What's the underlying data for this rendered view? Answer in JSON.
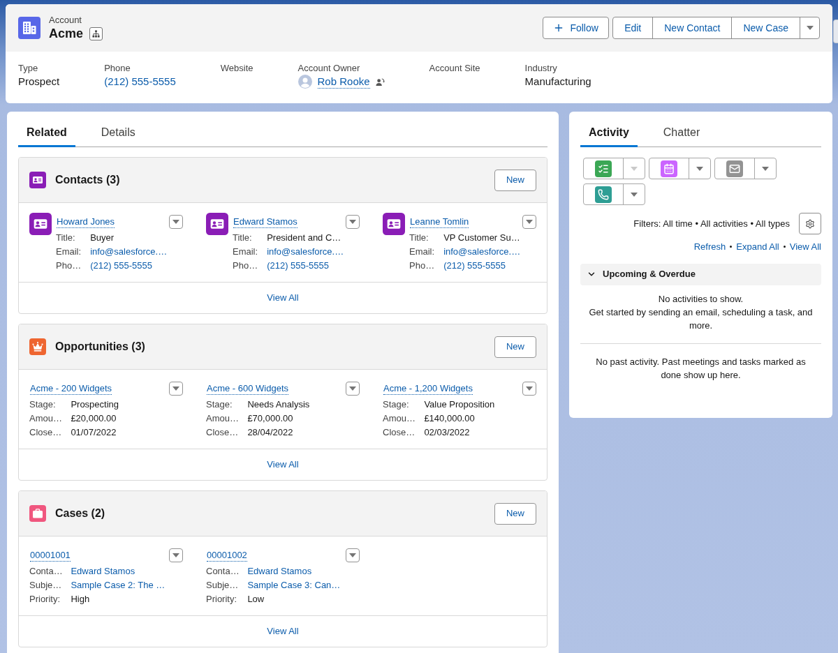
{
  "record_header": {
    "object_label": "Account",
    "title": "Acme",
    "follow_button": "Follow",
    "actions": [
      "Edit",
      "New Contact",
      "New Case"
    ]
  },
  "highlights": [
    {
      "label": "Type",
      "kind": "text",
      "value": "Prospect"
    },
    {
      "label": "Phone",
      "kind": "link",
      "value": "(212) 555-5555"
    },
    {
      "label": "Website"
    },
    {
      "label": "Account Owner",
      "kind": "owner",
      "value": "Rob Rooke"
    },
    {
      "label": "Account Site"
    },
    {
      "label": "Industry",
      "kind": "text",
      "value": "Manufacturing"
    }
  ],
  "main_tabs": [
    {
      "label": "Related",
      "selected": true
    },
    {
      "label": "Details",
      "selected": false
    }
  ],
  "related_lists": [
    {
      "kind": "contacts",
      "title": "Contacts (3)",
      "new_button": "New",
      "footer_link": "View All",
      "tiles": [
        {
          "name": "Howard Jones",
          "fields": [
            {
              "label": "Title:",
              "kind": "text",
              "value": "Buyer"
            },
            {
              "label": "Email:",
              "kind": "link",
              "value": "info@salesforce.…"
            },
            {
              "label": "Pho…",
              "kind": "link",
              "value": "(212) 555-5555"
            }
          ]
        },
        {
          "name": "Edward Stamos",
          "fields": [
            {
              "label": "Title:",
              "kind": "text",
              "value": "President and C…"
            },
            {
              "label": "Email:",
              "kind": "link",
              "value": "info@salesforce.…"
            },
            {
              "label": "Pho…",
              "kind": "link",
              "value": "(212) 555-5555"
            }
          ]
        },
        {
          "name": "Leanne Tomlin",
          "fields": [
            {
              "label": "Title:",
              "kind": "text",
              "value": "VP Customer Su…"
            },
            {
              "label": "Email:",
              "kind": "link",
              "value": "info@salesforce.…"
            },
            {
              "label": "Pho…",
              "kind": "link",
              "value": "(212) 555-5555"
            }
          ]
        }
      ]
    },
    {
      "kind": "opportunities",
      "title": "Opportunities (3)",
      "new_button": "New",
      "footer_link": "View All",
      "tiles": [
        {
          "name": "Acme - 200 Widgets",
          "fields": [
            {
              "label": "Stage:",
              "kind": "text",
              "value": "Prospecting"
            },
            {
              "label": "Amou…",
              "kind": "text",
              "value": "£20,000.00"
            },
            {
              "label": "Close…",
              "kind": "text",
              "value": "01/07/2022"
            }
          ]
        },
        {
          "name": "Acme - 600 Widgets",
          "fields": [
            {
              "label": "Stage:",
              "kind": "text",
              "value": "Needs Analysis"
            },
            {
              "label": "Amou…",
              "kind": "text",
              "value": "£70,000.00"
            },
            {
              "label": "Close…",
              "kind": "text",
              "value": "28/04/2022"
            }
          ]
        },
        {
          "name": "Acme - 1,200 Widgets",
          "fields": [
            {
              "label": "Stage:",
              "kind": "text",
              "value": "Value Proposition"
            },
            {
              "label": "Amou…",
              "kind": "text",
              "value": "£140,000.00"
            },
            {
              "label": "Close…",
              "kind": "text",
              "value": "02/03/2022"
            }
          ]
        }
      ]
    },
    {
      "kind": "cases",
      "title": "Cases (2)",
      "new_button": "New",
      "footer_link": "View All",
      "tiles": [
        {
          "name": "00001001",
          "fields": [
            {
              "label": "Conta…",
              "kind": "link",
              "value": "Edward Stamos"
            },
            {
              "label": "Subje…",
              "kind": "link",
              "value": "Sample Case 2: The …"
            },
            {
              "label": "Priority:",
              "kind": "text",
              "value": "High"
            }
          ]
        },
        {
          "name": "00001002",
          "fields": [
            {
              "label": "Conta…",
              "kind": "link",
              "value": "Edward Stamos"
            },
            {
              "label": "Subje…",
              "kind": "link",
              "value": "Sample Case 3: Can…"
            },
            {
              "label": "Priority:",
              "kind": "text",
              "value": "Low"
            }
          ]
        }
      ]
    }
  ],
  "activity": {
    "tabs": [
      {
        "label": "Activity",
        "selected": true
      },
      {
        "label": "Chatter",
        "selected": false
      }
    ],
    "composer": [
      {
        "kind": "task",
        "menu_disabled": true
      },
      {
        "kind": "event",
        "menu_disabled": false
      },
      {
        "kind": "email",
        "menu_disabled": false
      },
      {
        "kind": "call",
        "menu_disabled": false
      }
    ],
    "filters": "Filters: All time • All activities • All types",
    "links": [
      "Refresh",
      "Expand All",
      "View All"
    ],
    "upcoming": {
      "title": "Upcoming & Overdue",
      "expanded": true,
      "messages": [
        "No activities to show.",
        "Get started by sending an email, scheduling a task, and more."
      ]
    },
    "past_message": "No past activity. Past meetings and tasks marked as done show up here."
  }
}
